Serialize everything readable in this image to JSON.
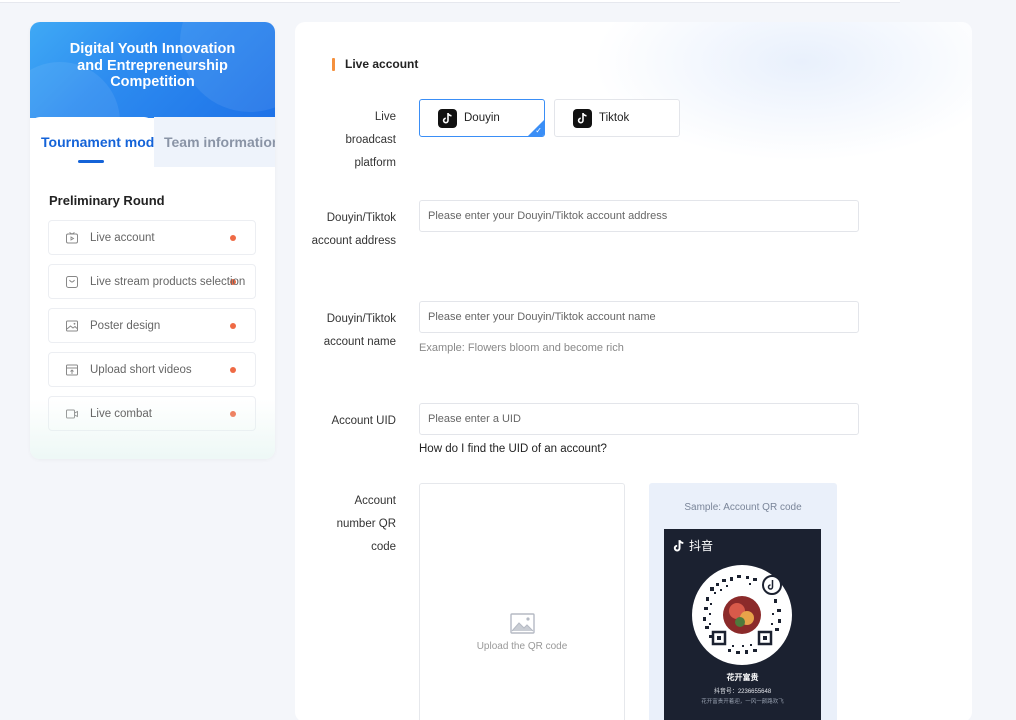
{
  "sidebar": {
    "header_title": "Digital Youth Innovation and Entrepreneurship Competition",
    "tabs": [
      {
        "label": "Tournament module",
        "active": true
      },
      {
        "label": "Team information",
        "active": false
      }
    ],
    "round_title": "Preliminary Round",
    "modules": [
      {
        "label": "Live account",
        "icon": "live-icon",
        "status_color": "#ef6a45"
      },
      {
        "label": "Live stream products selection",
        "icon": "bag-icon",
        "status_color": "#ef6a45"
      },
      {
        "label": "Poster design",
        "icon": "image-icon",
        "status_color": "#ef6a45"
      },
      {
        "label": "Upload short videos",
        "icon": "video-upload-icon",
        "status_color": "#ef6a45"
      },
      {
        "label": "Live combat",
        "icon": "camera-icon",
        "status_color": "#ef6a45"
      }
    ]
  },
  "main": {
    "section_title": "Live account",
    "platform": {
      "label": "Live broadcast platform",
      "options": [
        {
          "label": "Douyin",
          "selected": true
        },
        {
          "label": "Tiktok",
          "selected": false
        }
      ]
    },
    "account_address": {
      "label": "Douyin/Tiktok account address",
      "placeholder": "Please enter your Douyin/Tiktok account address",
      "value": ""
    },
    "account_name": {
      "label": "Douyin/Tiktok account name",
      "placeholder": "Please enter your Douyin/Tiktok account name",
      "value": "",
      "hint": "Example: Flowers bloom and become rich"
    },
    "account_uid": {
      "label": "Account UID",
      "placeholder": "Please enter a UID",
      "value": "",
      "help_link": "How do I find the UID of an account?"
    },
    "qr_code": {
      "label": "Account number QR code",
      "upload_text": "Upload the QR code",
      "sample_title": "Sample: Account QR code",
      "sample_brand": "抖音",
      "sample_name": "花开富贵",
      "sample_id": "抖音号：2236655648",
      "sample_desc": "花开富贵开着迎，一风一颜路欢飞"
    }
  },
  "colors": {
    "accent": "#1463d8",
    "selected_border": "#3a8ef6",
    "section_bar": "#f5903d",
    "status_dot": "#ef6a45"
  }
}
